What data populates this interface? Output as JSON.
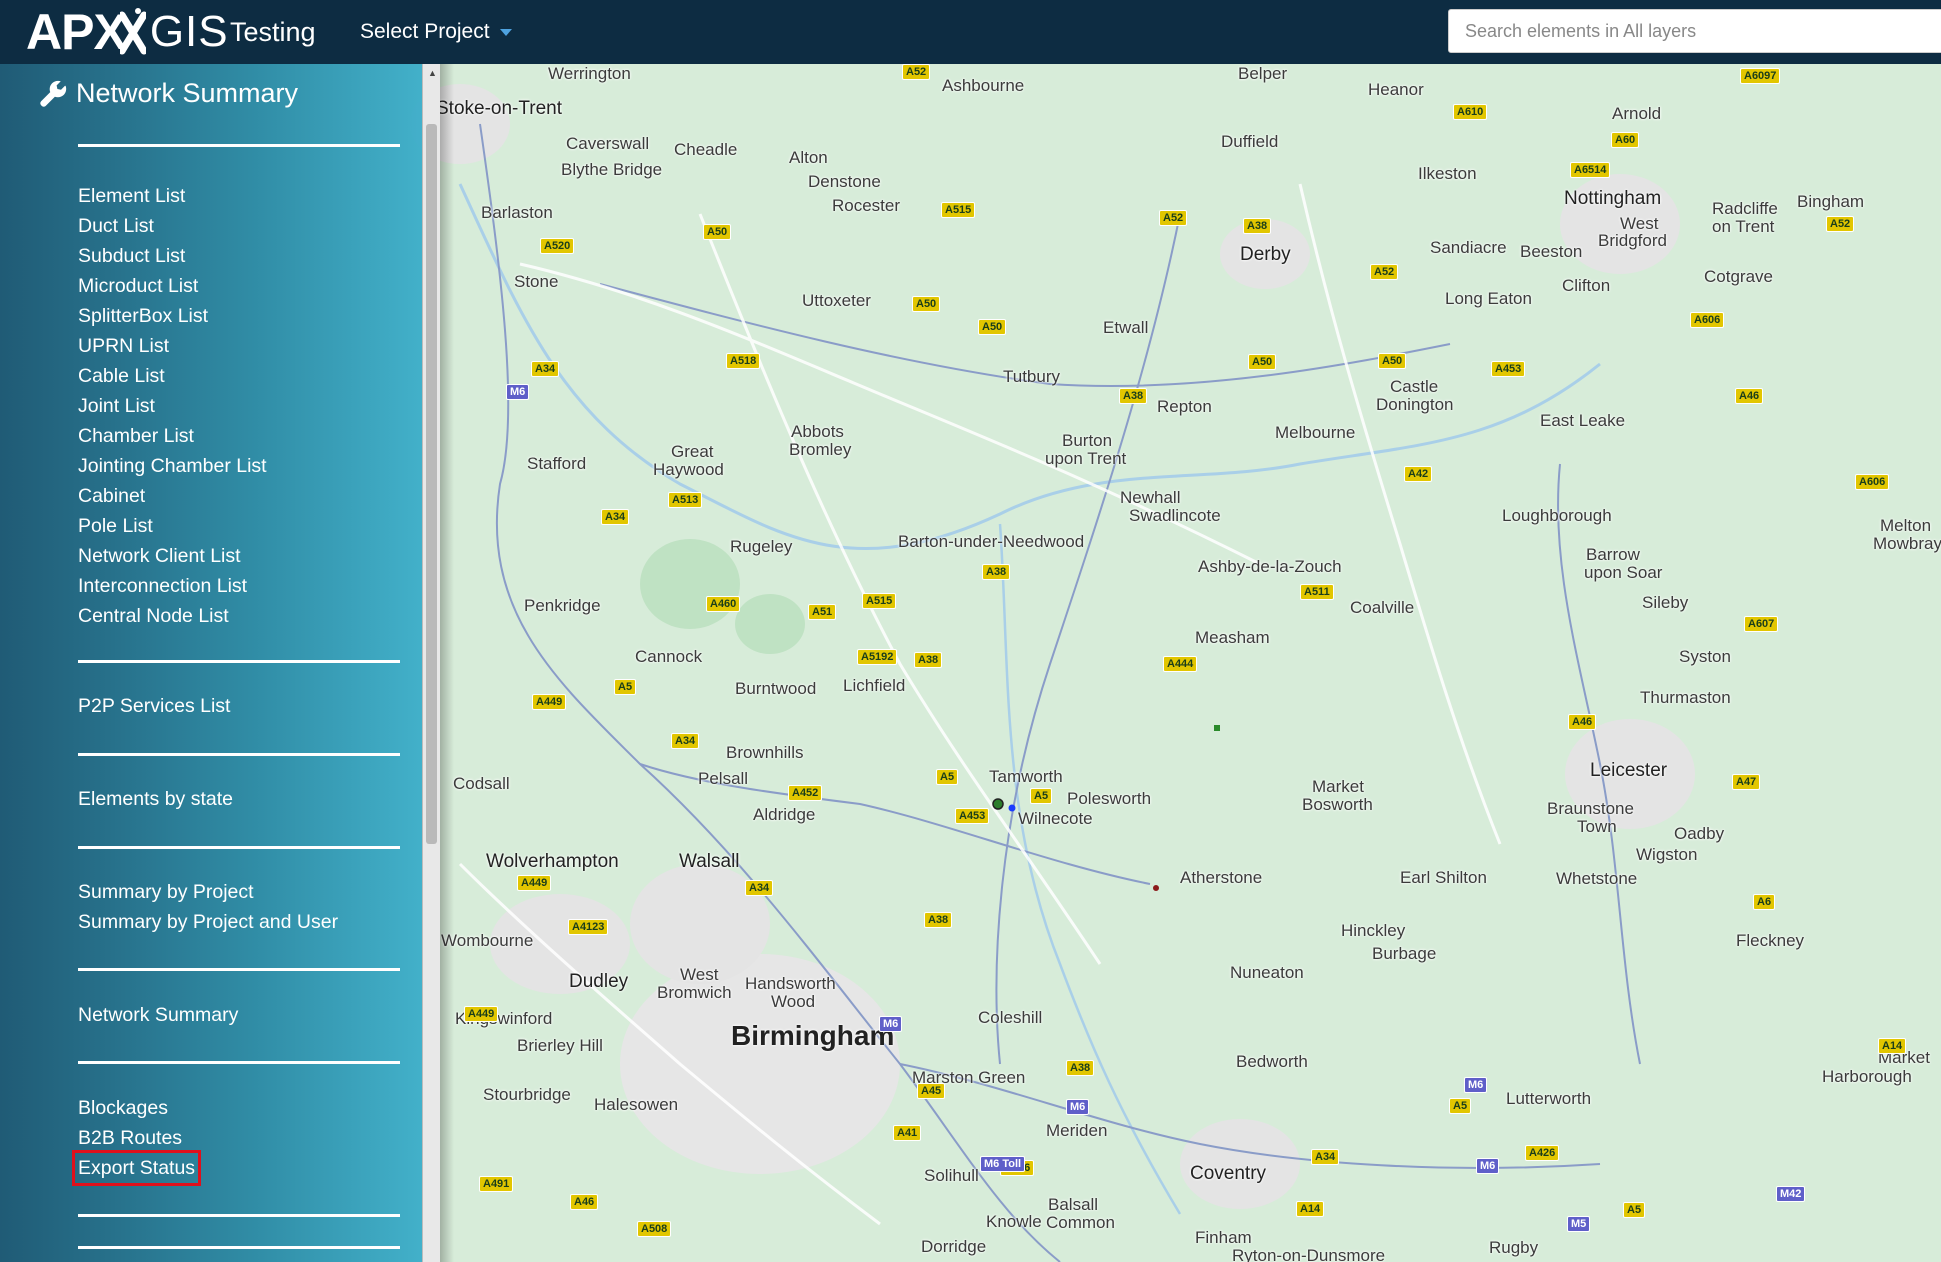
{
  "header": {
    "logo_apx": "APX",
    "logo_gis": "GIS",
    "environment": "Testing",
    "project_select_label": "Select Project",
    "search_placeholder": "Search elements in All layers"
  },
  "sidebar": {
    "title": "Network Summary",
    "groups": [
      [
        "Element List",
        "Duct List",
        "Subduct List",
        "Microduct List",
        "SplitterBox List",
        "UPRN List",
        "Cable List",
        "Joint List",
        "Chamber List",
        "Jointing Chamber List",
        "Cabinet",
        "Pole List",
        "Network Client List",
        "Interconnection List",
        "Central Node List"
      ],
      [
        "P2P Services List"
      ],
      [
        "Elements by state"
      ],
      [
        "Summary by Project",
        "Summary by Project and User"
      ],
      [
        "Network Summary"
      ],
      [
        "Blockages",
        "B2B Routes",
        "Export Status"
      ]
    ],
    "highlighted_item": "Export Status"
  },
  "map": {
    "towns": [
      {
        "name": "Werrington",
        "cls": ""
      },
      {
        "name": "Ashbourne",
        "cls": ""
      },
      {
        "name": "Belper",
        "cls": ""
      },
      {
        "name": "Heanor",
        "cls": ""
      },
      {
        "name": "Arnold",
        "cls": ""
      },
      {
        "name": "Stoke-on-Trent",
        "cls": "big"
      },
      {
        "name": "Caverswall",
        "cls": ""
      },
      {
        "name": "Cheadle",
        "cls": ""
      },
      {
        "name": "Alton",
        "cls": ""
      },
      {
        "name": "Duffield",
        "cls": ""
      },
      {
        "name": "Blythe Bridge",
        "cls": ""
      },
      {
        "name": "Denstone",
        "cls": ""
      },
      {
        "name": "Ilkeston",
        "cls": ""
      },
      {
        "name": "Nottingham",
        "cls": "big"
      },
      {
        "name": "Radcliffe",
        "cls": ""
      },
      {
        "name": "on Trent",
        "cls": ""
      },
      {
        "name": "Bingham",
        "cls": ""
      },
      {
        "name": "Barlaston",
        "cls": ""
      },
      {
        "name": "Rocester",
        "cls": ""
      },
      {
        "name": "West",
        "cls": ""
      },
      {
        "name": "Bridgford",
        "cls": ""
      },
      {
        "name": "Derby",
        "cls": "big"
      },
      {
        "name": "Sandiacre",
        "cls": ""
      },
      {
        "name": "Beeston",
        "cls": ""
      },
      {
        "name": "Stone",
        "cls": ""
      },
      {
        "name": "Cotgrave",
        "cls": ""
      },
      {
        "name": "Clifton",
        "cls": ""
      },
      {
        "name": "Uttoxeter",
        "cls": ""
      },
      {
        "name": "Long Eaton",
        "cls": ""
      },
      {
        "name": "Etwall",
        "cls": ""
      },
      {
        "name": "Tutbury",
        "cls": ""
      },
      {
        "name": "Castle",
        "cls": ""
      },
      {
        "name": "Donington",
        "cls": ""
      },
      {
        "name": "Repton",
        "cls": ""
      },
      {
        "name": "Abbots",
        "cls": ""
      },
      {
        "name": "Bromley",
        "cls": ""
      },
      {
        "name": "Melbourne",
        "cls": ""
      },
      {
        "name": "East Leake",
        "cls": ""
      },
      {
        "name": "Burton",
        "cls": ""
      },
      {
        "name": "upon Trent",
        "cls": ""
      },
      {
        "name": "Great",
        "cls": ""
      },
      {
        "name": "Haywood",
        "cls": ""
      },
      {
        "name": "Stafford",
        "cls": ""
      },
      {
        "name": "Newhall",
        "cls": ""
      },
      {
        "name": "Swadlincote",
        "cls": ""
      },
      {
        "name": "Loughborough",
        "cls": ""
      },
      {
        "name": "Melton",
        "cls": ""
      },
      {
        "name": "Mowbray",
        "cls": ""
      },
      {
        "name": "Barton-under-Needwood",
        "cls": ""
      },
      {
        "name": "Rugeley",
        "cls": ""
      },
      {
        "name": "Barrow",
        "cls": ""
      },
      {
        "name": "upon Soar",
        "cls": ""
      },
      {
        "name": "Ashby-de-la-Zouch",
        "cls": ""
      },
      {
        "name": "Sileby",
        "cls": ""
      },
      {
        "name": "Penkridge",
        "cls": ""
      },
      {
        "name": "Coalville",
        "cls": ""
      },
      {
        "name": "Measham",
        "cls": ""
      },
      {
        "name": "Cannock",
        "cls": ""
      },
      {
        "name": "Syston",
        "cls": ""
      },
      {
        "name": "Burntwood",
        "cls": ""
      },
      {
        "name": "Lichfield",
        "cls": ""
      },
      {
        "name": "Thurmaston",
        "cls": ""
      },
      {
        "name": "Brownhills",
        "cls": ""
      },
      {
        "name": "Leicester",
        "cls": "big"
      },
      {
        "name": "Tamworth",
        "cls": ""
      },
      {
        "name": "Pelsall",
        "cls": ""
      },
      {
        "name": "Codsall",
        "cls": ""
      },
      {
        "name": "Market",
        "cls": ""
      },
      {
        "name": "Bosworth",
        "cls": ""
      },
      {
        "name": "Polesworth",
        "cls": ""
      },
      {
        "name": "Braunstone",
        "cls": ""
      },
      {
        "name": "Town",
        "cls": ""
      },
      {
        "name": "Aldridge",
        "cls": ""
      },
      {
        "name": "Wilnecote",
        "cls": ""
      },
      {
        "name": "Oadby",
        "cls": ""
      },
      {
        "name": "Wolverhampton",
        "cls": "big"
      },
      {
        "name": "Walsall",
        "cls": "big"
      },
      {
        "name": "Wigston",
        "cls": ""
      },
      {
        "name": "Atherstone",
        "cls": ""
      },
      {
        "name": "Earl Shilton",
        "cls": ""
      },
      {
        "name": "Whetstone",
        "cls": ""
      },
      {
        "name": "Hinckley",
        "cls": ""
      },
      {
        "name": "Wombourne",
        "cls": ""
      },
      {
        "name": "Fleckney",
        "cls": ""
      },
      {
        "name": "Burbage",
        "cls": ""
      },
      {
        "name": "West",
        "cls": ""
      },
      {
        "name": "Bromwich",
        "cls": ""
      },
      {
        "name": "Handsworth",
        "cls": ""
      },
      {
        "name": "Wood",
        "cls": ""
      },
      {
        "name": "Nuneaton",
        "cls": ""
      },
      {
        "name": "Dudley",
        "cls": "big"
      },
      {
        "name": "Coleshill",
        "cls": ""
      },
      {
        "name": "Kingswinford",
        "cls": ""
      },
      {
        "name": "Birmingham",
        "cls": "city"
      },
      {
        "name": "Brierley Hill",
        "cls": ""
      },
      {
        "name": "Bedworth",
        "cls": ""
      },
      {
        "name": "Market",
        "cls": ""
      },
      {
        "name": "Harborough",
        "cls": ""
      },
      {
        "name": "Marston Green",
        "cls": ""
      },
      {
        "name": "Stourbridge",
        "cls": ""
      },
      {
        "name": "Lutterworth",
        "cls": ""
      },
      {
        "name": "Halesowen",
        "cls": ""
      },
      {
        "name": "Meriden",
        "cls": ""
      },
      {
        "name": "Coventry",
        "cls": "big"
      },
      {
        "name": "Solihull",
        "cls": ""
      },
      {
        "name": "Balsall",
        "cls": ""
      },
      {
        "name": "Common",
        "cls": ""
      },
      {
        "name": "Knowle",
        "cls": ""
      },
      {
        "name": "Finham",
        "cls": ""
      },
      {
        "name": "Dorridge",
        "cls": ""
      },
      {
        "name": "Rugby",
        "cls": ""
      },
      {
        "name": "Ryton-on-Dunsmore",
        "cls": ""
      }
    ],
    "roads": [
      "A52",
      "A6097",
      "A610",
      "A60",
      "A6514",
      "A52",
      "A38",
      "A515",
      "A52",
      "A50",
      "A520",
      "A50",
      "A52",
      "A606",
      "A50",
      "A34",
      "A518",
      "A50",
      "A50",
      "A453",
      "M6",
      "A38",
      "A46",
      "A42",
      "A606",
      "A513",
      "A34",
      "A38",
      "A511",
      "A460",
      "A51",
      "A515",
      "A5192",
      "A38",
      "A607",
      "A444",
      "A5",
      "A449",
      "A34",
      "A46",
      "A5",
      "A452",
      "A5",
      "A453",
      "A47",
      "A449",
      "A34",
      "A38",
      "A4123",
      "A6",
      "A449",
      "M6",
      "A38",
      "M6",
      "A45",
      "A5",
      "A41",
      "M6",
      "A34",
      "M6",
      "A426",
      "A456",
      "A491",
      "A46",
      "A14",
      "A5",
      "M5",
      "A508",
      "A14",
      "M42",
      "M6 Toll"
    ]
  },
  "colors": {
    "topbar": "#0d2c42",
    "highlight_outline": "#e0101c",
    "sidebar": "#1e82a0"
  }
}
